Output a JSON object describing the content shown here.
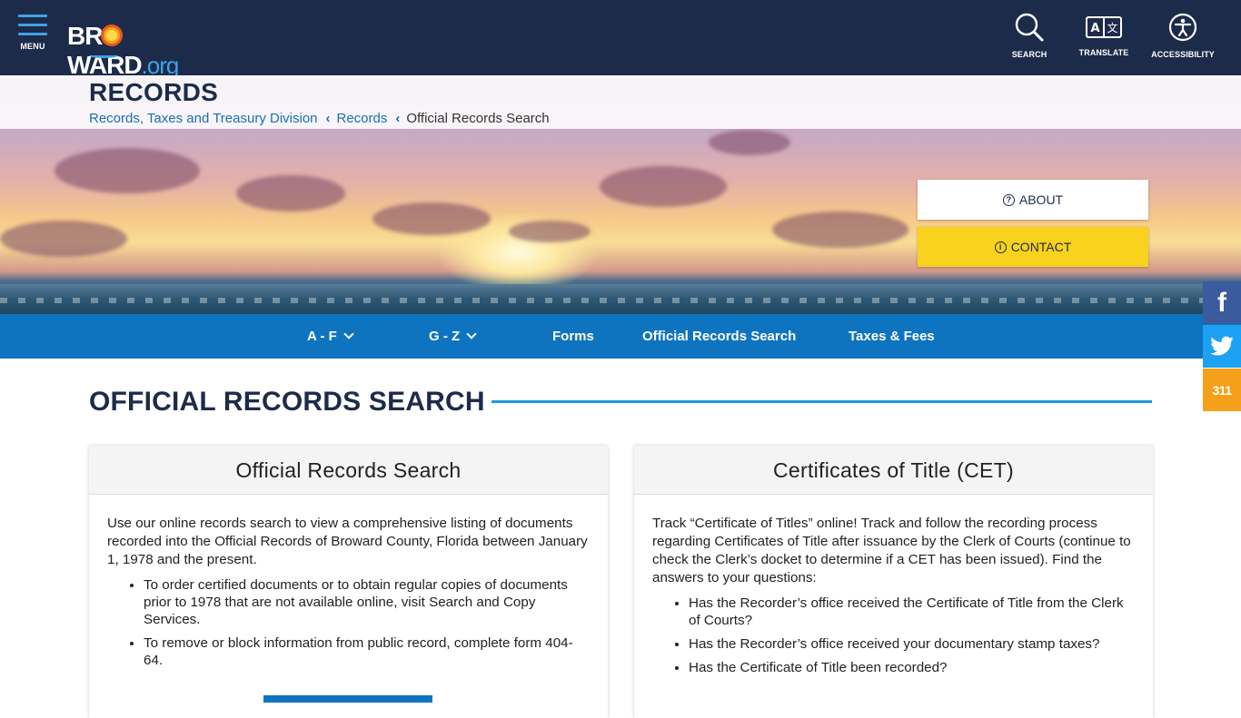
{
  "header": {
    "menu_label": "MENU",
    "logo": {
      "text_main": "BROWARD",
      "text_suffix": ".org"
    },
    "tools": {
      "search_label": "SEARCH",
      "translate_label": "TRANSLATE",
      "accessibility_label": "ACCESSIBILITY"
    }
  },
  "hero": {
    "page_title": "RECORDS",
    "breadcrumb": [
      "Records, Taxes and Treasury Division",
      "Records",
      "Official Records Search"
    ],
    "about_label": "ABOUT",
    "contact_label": "CONTACT"
  },
  "subnav": {
    "items": [
      "A - F",
      "G - Z",
      "Forms",
      "Official Records Search",
      "Taxes & Fees"
    ]
  },
  "social": {
    "facebook_glyph": "f",
    "three_one_one": "311"
  },
  "section": {
    "title": "OFFICIAL RECORDS SEARCH"
  },
  "cards": [
    {
      "title": "Official Records Search",
      "intro": "Use our online records search to view a comprehensive listing of documents recorded into the Official Records of Broward County, Florida between January 1, 1978 and the present.",
      "bullets": [
        "To order certified documents or to obtain regular copies of documents prior to 1978 that are not available online, visit Search and Copy Services.",
        "To remove or block information from public record, complete form 404-64."
      ]
    },
    {
      "title": "Certificates of Title (CET)",
      "intro": "Track “Certificate of Titles” online! Track and follow the recording process regarding Certificates of Title after issuance by the Clerk of Courts (continue to check the Clerk’s docket to determine if a CET has been issued). Find the answers to your questions:",
      "bullets": [
        "Has the Recorder’s office received the Certificate of Title from the Clerk of Courts?",
        "Has the Recorder’s office received your documentary stamp taxes?",
        "Has the Certificate of Title been recorded?"
      ]
    }
  ],
  "colors": {
    "header_bg": "#1d2b4a",
    "nav_blue": "#0f74bf",
    "accent_yellow": "#f8d21c",
    "rule_blue": "#1a9ad6",
    "facebook": "#3a5b9d",
    "twitter": "#1da1f2",
    "orange_311": "#f5a01a"
  }
}
